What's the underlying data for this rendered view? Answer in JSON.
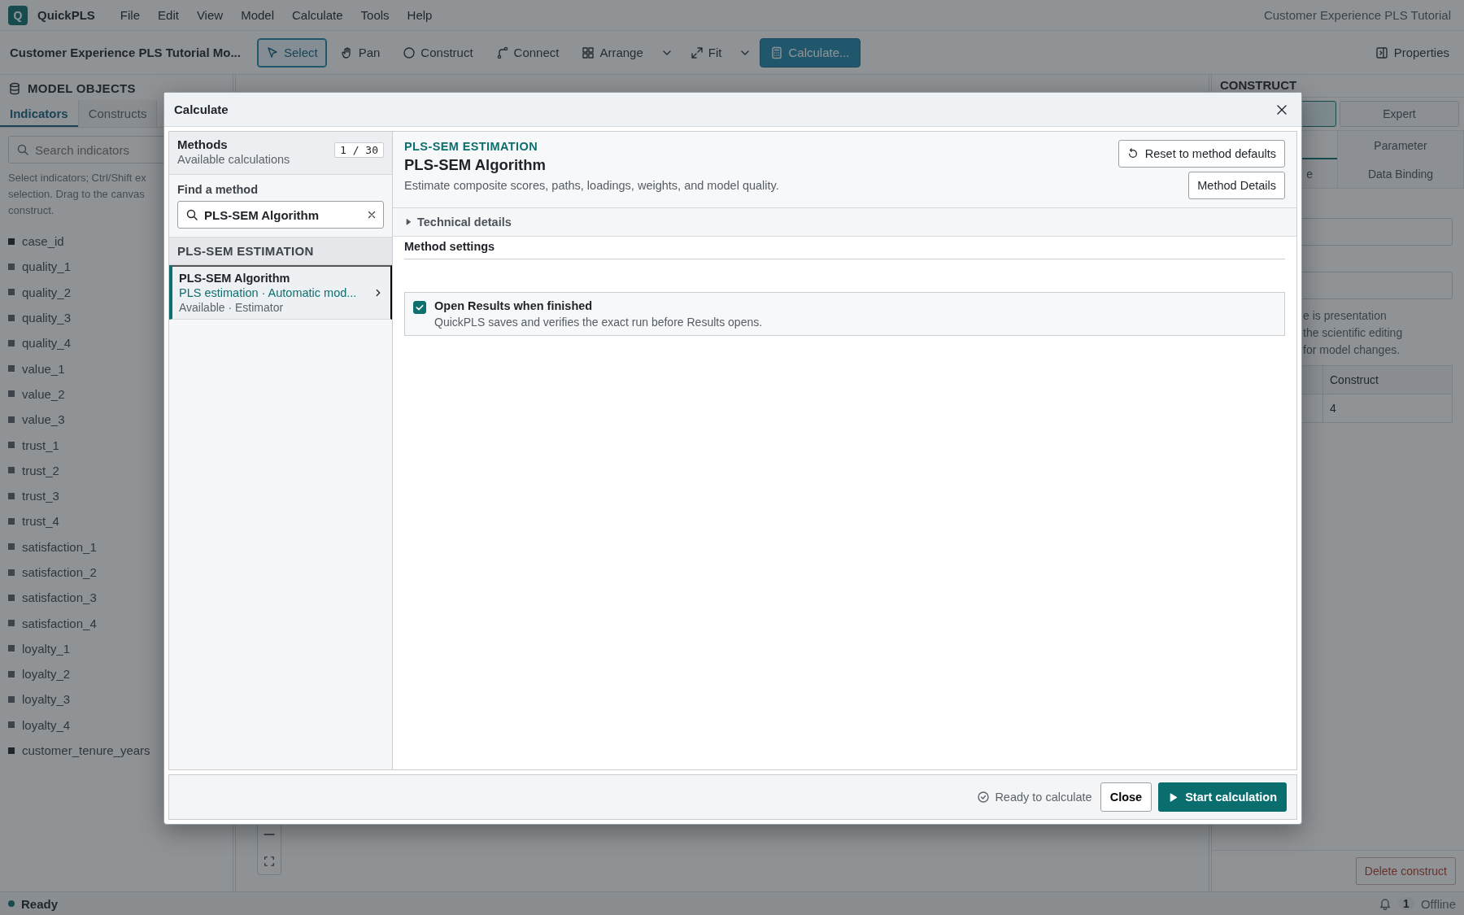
{
  "app": {
    "logo": "Q",
    "name": "QuickPLS",
    "menu": [
      "File",
      "Edit",
      "View",
      "Model",
      "Calculate",
      "Tools",
      "Help"
    ],
    "window_title": "Customer Experience PLS Tutorial"
  },
  "toolbar": {
    "project_title": "Customer Experience PLS Tutorial Mo...",
    "tools": [
      {
        "kind": "select",
        "label": "Select",
        "selected": true
      },
      {
        "kind": "pan",
        "label": "Pan",
        "selected": false
      },
      {
        "kind": "construct",
        "label": "Construct",
        "selected": false
      },
      {
        "kind": "connect",
        "label": "Connect",
        "selected": false
      },
      {
        "kind": "arrange",
        "label": "Arrange",
        "selected": false,
        "dropdown": true
      },
      {
        "kind": "fit",
        "label": "Fit",
        "selected": false,
        "dropdown": true
      }
    ],
    "calculate": "Calculate...",
    "properties": "Properties"
  },
  "left_panel": {
    "title": "MODEL OBJECTS",
    "tabs": [
      {
        "label": "Indicators",
        "selected": true
      },
      {
        "label": "Constructs",
        "selected": false
      }
    ],
    "search": {
      "placeholder": "Search indicators"
    },
    "hint_lines": [
      "Select indicators; Ctrl/Shift ex",
      "selection. Drag to the canvas",
      "construct."
    ],
    "indicators": [
      {
        "name": "case_id",
        "kind": "meta"
      },
      {
        "name": "quality_1",
        "kind": "indicator"
      },
      {
        "name": "quality_2",
        "kind": "indicator"
      },
      {
        "name": "quality_3",
        "kind": "indicator"
      },
      {
        "name": "quality_4",
        "kind": "indicator"
      },
      {
        "name": "value_1",
        "kind": "indicator"
      },
      {
        "name": "value_2",
        "kind": "indicator"
      },
      {
        "name": "value_3",
        "kind": "indicator"
      },
      {
        "name": "trust_1",
        "kind": "indicator"
      },
      {
        "name": "trust_2",
        "kind": "indicator"
      },
      {
        "name": "trust_3",
        "kind": "indicator"
      },
      {
        "name": "trust_4",
        "kind": "indicator"
      },
      {
        "name": "satisfaction_1",
        "kind": "indicator"
      },
      {
        "name": "satisfaction_2",
        "kind": "indicator"
      },
      {
        "name": "satisfaction_3",
        "kind": "indicator"
      },
      {
        "name": "satisfaction_4",
        "kind": "indicator"
      },
      {
        "name": "loyalty_1",
        "kind": "indicator"
      },
      {
        "name": "loyalty_2",
        "kind": "indicator"
      },
      {
        "name": "loyalty_3",
        "kind": "indicator"
      },
      {
        "name": "loyalty_4",
        "kind": "indicator"
      },
      {
        "name": "customer_tenure_years",
        "kind": "meta"
      }
    ]
  },
  "right_panel": {
    "title": "CONSTRUCT",
    "modes": [
      {
        "label": "Expert",
        "selected": false
      }
    ],
    "tabs": [
      {
        "label": "Parameter",
        "selected": false
      },
      {
        "label": "e",
        "selected": false
      },
      {
        "label": "Data Binding",
        "selected": false
      }
    ],
    "hint_lines": [
      "e is presentation",
      "the scientific editing",
      "for model changes."
    ],
    "table": {
      "columns": [
        "Construct"
      ],
      "rows": [
        [
          "4"
        ]
      ]
    },
    "delete": "Delete construct"
  },
  "status_bar": {
    "status": "Ready",
    "notifications": "1",
    "connection": "Offline"
  },
  "dialog": {
    "title": "Calculate",
    "methods": {
      "title": "Methods",
      "subtitle": "Available calculations",
      "count": "1 / 30",
      "find_label": "Find a method",
      "search_value": "PLS-SEM Algorithm",
      "groups": [
        {
          "title": "PLS-SEM ESTIMATION",
          "items": [
            {
              "name": "PLS-SEM Algorithm",
              "summary": "PLS estimation · Automatic mod...",
              "meta": "Available · Estimator",
              "selected": true
            }
          ]
        }
      ]
    },
    "detail": {
      "category": "PLS-SEM ESTIMATION",
      "title": "PLS-SEM Algorithm",
      "description": "Estimate composite scores, paths, loadings, weights, and model quality.",
      "reset": "Reset to method defaults",
      "details": "Method Details",
      "technical_details": {
        "label": "Technical details",
        "expanded": false
      },
      "settings_title": "Method settings",
      "options": [
        {
          "label": "Open Results when finished",
          "description": "QuickPLS saves and verifies the exact run before Results opens.",
          "checked": true
        }
      ]
    },
    "footer": {
      "status": "Ready to calculate",
      "close": "Close",
      "start": "Start calculation"
    }
  }
}
